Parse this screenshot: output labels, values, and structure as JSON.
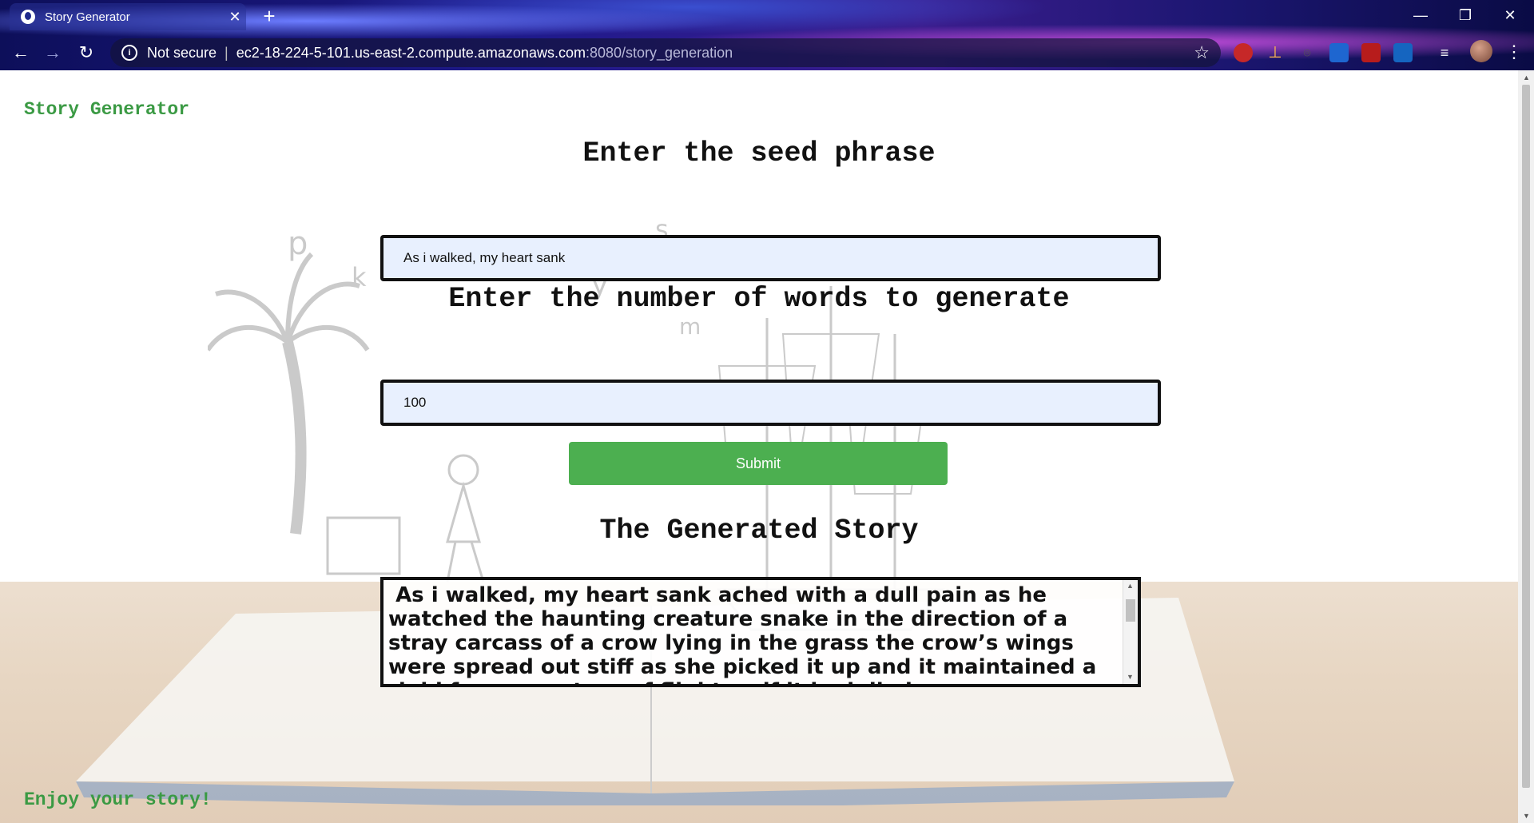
{
  "browser": {
    "tab_title": "Story Generator",
    "tab_close": "✕",
    "new_tab": "+",
    "url_security": "Not secure",
    "url_separator": "|",
    "url_host": "ec2-18-224-5-101.us-east-2.compute.amazonaws.com",
    "url_path": ":8080/story_generation",
    "window_controls": [
      "—",
      "❐",
      "✕"
    ]
  },
  "page": {
    "brand": "Story Generator",
    "seed_heading": "Enter the seed phrase",
    "seed_value": "As i walked, my heart sank",
    "words_heading": "Enter the number of words to generate",
    "words_value": "100",
    "submit_label": "Submit",
    "story_heading": "The Generated Story",
    "story_text": " As i walked, my heart sank ached with a dull pain as he watched the haunting creature snake in the direction of a stray carcass of a crow lying in the grass the crow’s wings were spread out stiff as she picked it up and it maintained a rigid frozen posture of flight as if it had died...",
    "footer": "Enjoy your story!"
  },
  "icons": [
    "globe-icon",
    "back-icon",
    "forward-icon",
    "reload-icon",
    "info-icon",
    "star-icon",
    "menu-icon"
  ]
}
